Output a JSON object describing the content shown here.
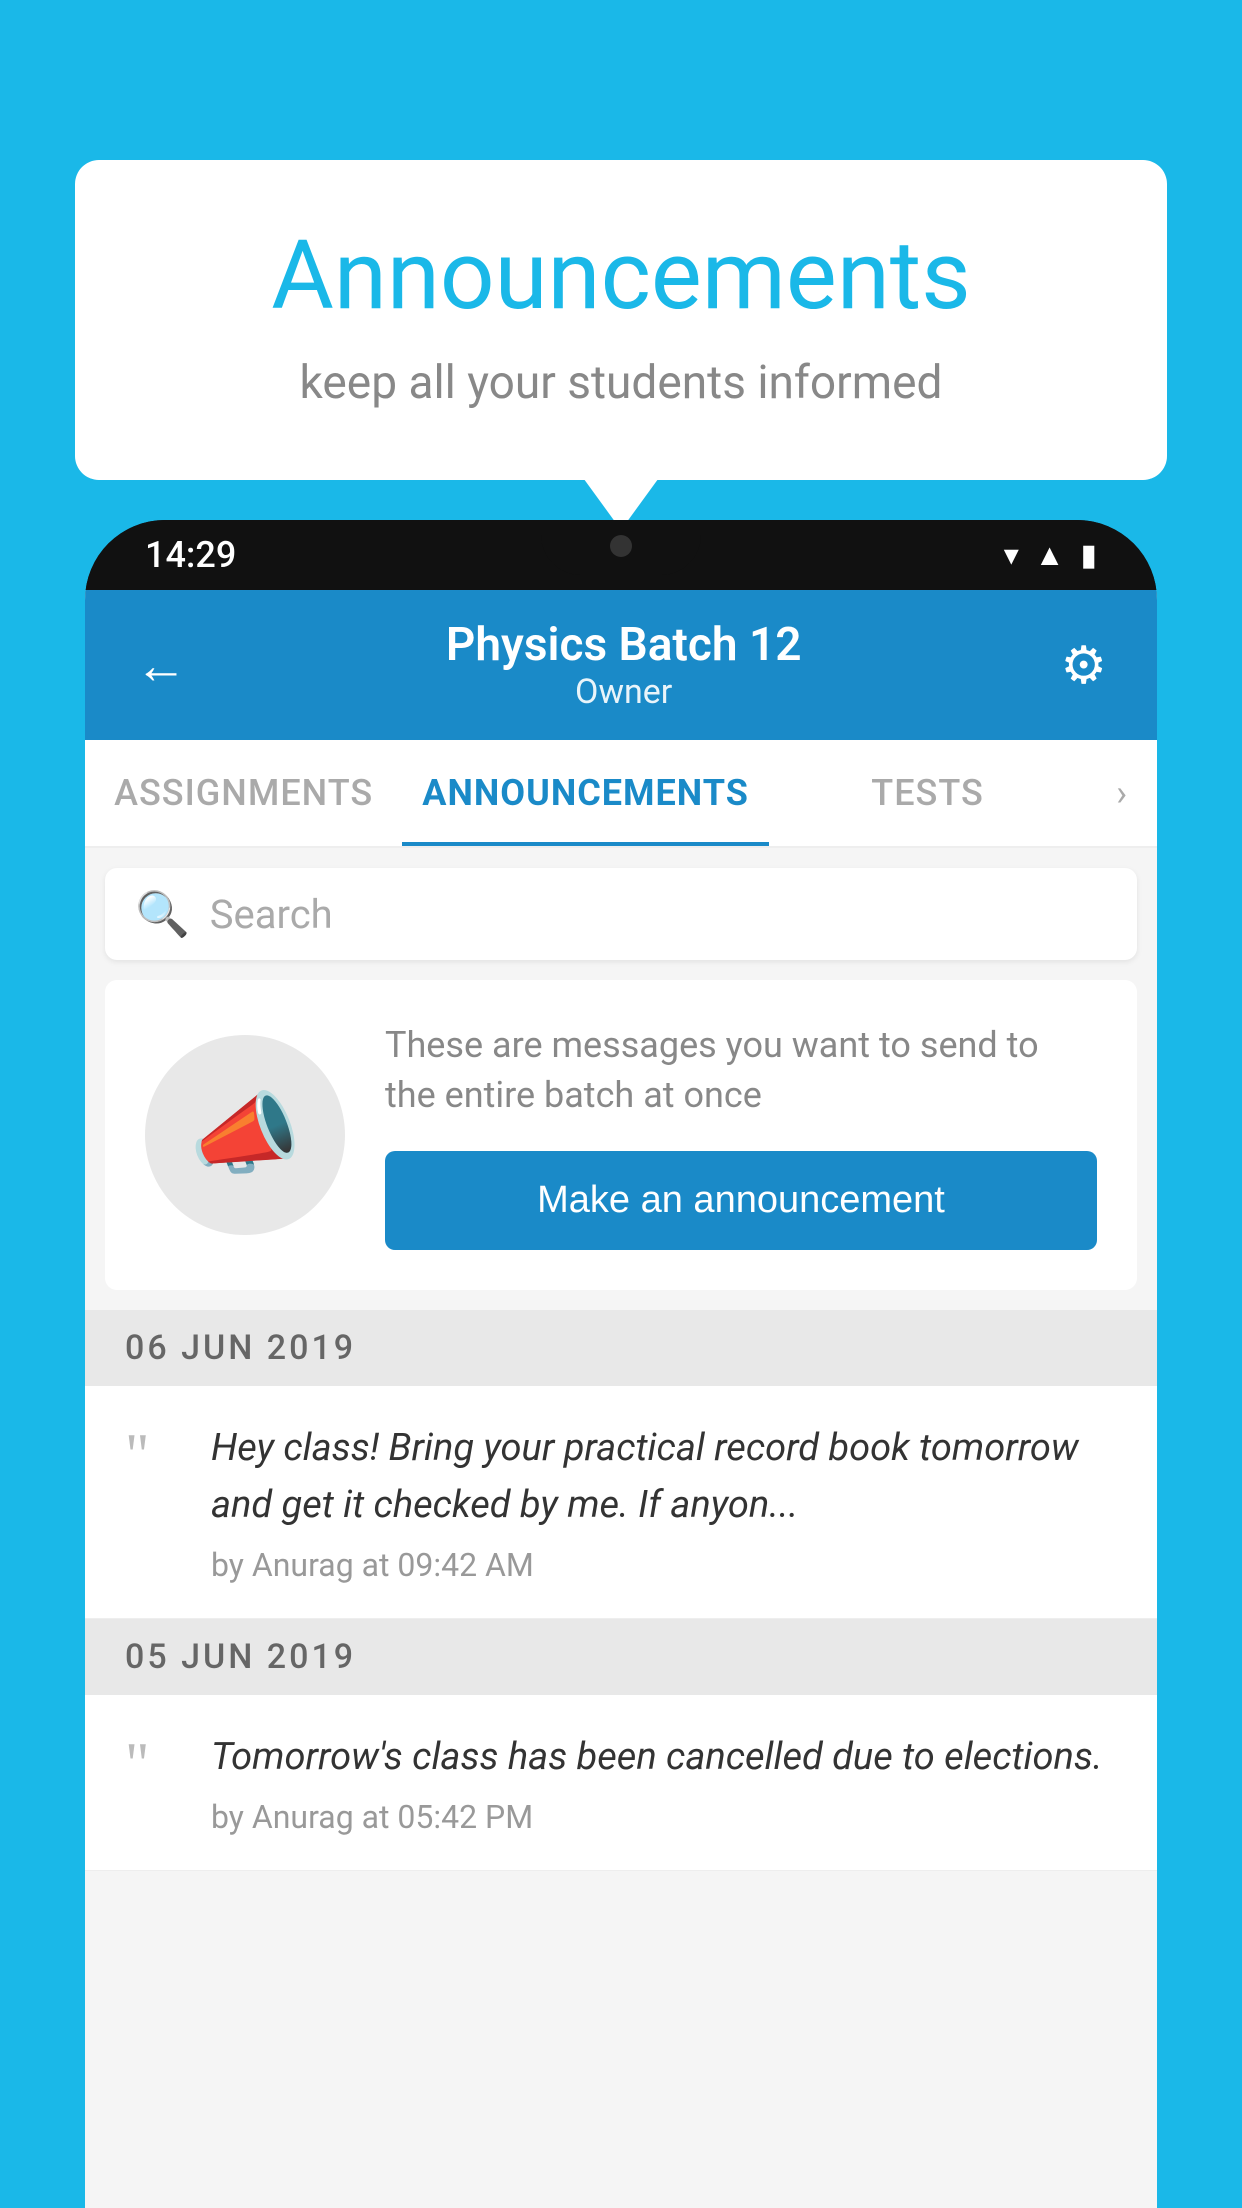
{
  "background_color": "#1ab8e8",
  "speech_bubble": {
    "title": "Announcements",
    "subtitle": "keep all your students informed"
  },
  "phone": {
    "status_bar": {
      "time": "14:29",
      "wifi_icon": "▼",
      "signal_icon": "▲",
      "battery_icon": "▮"
    },
    "header": {
      "back_label": "←",
      "title": "Physics Batch 12",
      "subtitle": "Owner",
      "settings_icon": "⚙"
    },
    "tabs": [
      {
        "label": "ASSIGNMENTS",
        "active": false
      },
      {
        "label": "ANNOUNCEMENTS",
        "active": true
      },
      {
        "label": "TESTS",
        "active": false
      }
    ],
    "search": {
      "placeholder": "Search",
      "icon": "🔍"
    },
    "promo": {
      "description": "These are messages you want to send to the entire batch at once",
      "button_label": "Make an announcement"
    },
    "announcements": [
      {
        "date": "06  JUN  2019",
        "items": [
          {
            "text": "Hey class! Bring your practical record book tomorrow and get it checked by me. If anyon...",
            "meta": "by Anurag at 09:42 AM"
          }
        ]
      },
      {
        "date": "05  JUN  2019",
        "items": [
          {
            "text": "Tomorrow's class has been cancelled due to elections.",
            "meta": "by Anurag at 05:42 PM"
          }
        ]
      }
    ]
  }
}
